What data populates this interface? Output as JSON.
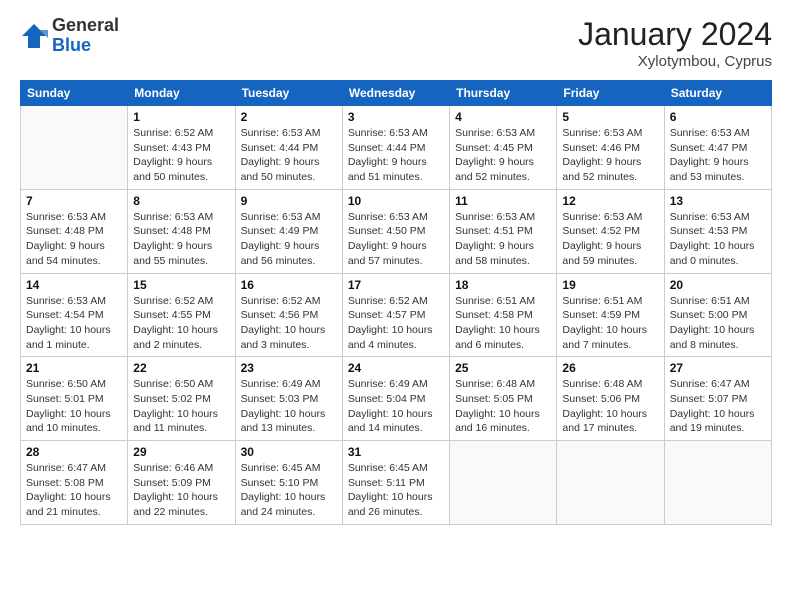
{
  "header": {
    "logo_general": "General",
    "logo_blue": "Blue",
    "month_title": "January 2024",
    "subtitle": "Xylotymbou, Cyprus"
  },
  "weekdays": [
    "Sunday",
    "Monday",
    "Tuesday",
    "Wednesday",
    "Thursday",
    "Friday",
    "Saturday"
  ],
  "weeks": [
    [
      {
        "day": "",
        "info": ""
      },
      {
        "day": "1",
        "info": "Sunrise: 6:52 AM\nSunset: 4:43 PM\nDaylight: 9 hours\nand 50 minutes."
      },
      {
        "day": "2",
        "info": "Sunrise: 6:53 AM\nSunset: 4:44 PM\nDaylight: 9 hours\nand 50 minutes."
      },
      {
        "day": "3",
        "info": "Sunrise: 6:53 AM\nSunset: 4:44 PM\nDaylight: 9 hours\nand 51 minutes."
      },
      {
        "day": "4",
        "info": "Sunrise: 6:53 AM\nSunset: 4:45 PM\nDaylight: 9 hours\nand 52 minutes."
      },
      {
        "day": "5",
        "info": "Sunrise: 6:53 AM\nSunset: 4:46 PM\nDaylight: 9 hours\nand 52 minutes."
      },
      {
        "day": "6",
        "info": "Sunrise: 6:53 AM\nSunset: 4:47 PM\nDaylight: 9 hours\nand 53 minutes."
      }
    ],
    [
      {
        "day": "7",
        "info": "Sunrise: 6:53 AM\nSunset: 4:48 PM\nDaylight: 9 hours\nand 54 minutes."
      },
      {
        "day": "8",
        "info": "Sunrise: 6:53 AM\nSunset: 4:48 PM\nDaylight: 9 hours\nand 55 minutes."
      },
      {
        "day": "9",
        "info": "Sunrise: 6:53 AM\nSunset: 4:49 PM\nDaylight: 9 hours\nand 56 minutes."
      },
      {
        "day": "10",
        "info": "Sunrise: 6:53 AM\nSunset: 4:50 PM\nDaylight: 9 hours\nand 57 minutes."
      },
      {
        "day": "11",
        "info": "Sunrise: 6:53 AM\nSunset: 4:51 PM\nDaylight: 9 hours\nand 58 minutes."
      },
      {
        "day": "12",
        "info": "Sunrise: 6:53 AM\nSunset: 4:52 PM\nDaylight: 9 hours\nand 59 minutes."
      },
      {
        "day": "13",
        "info": "Sunrise: 6:53 AM\nSunset: 4:53 PM\nDaylight: 10 hours\nand 0 minutes."
      }
    ],
    [
      {
        "day": "14",
        "info": "Sunrise: 6:53 AM\nSunset: 4:54 PM\nDaylight: 10 hours\nand 1 minute."
      },
      {
        "day": "15",
        "info": "Sunrise: 6:52 AM\nSunset: 4:55 PM\nDaylight: 10 hours\nand 2 minutes."
      },
      {
        "day": "16",
        "info": "Sunrise: 6:52 AM\nSunset: 4:56 PM\nDaylight: 10 hours\nand 3 minutes."
      },
      {
        "day": "17",
        "info": "Sunrise: 6:52 AM\nSunset: 4:57 PM\nDaylight: 10 hours\nand 4 minutes."
      },
      {
        "day": "18",
        "info": "Sunrise: 6:51 AM\nSunset: 4:58 PM\nDaylight: 10 hours\nand 6 minutes."
      },
      {
        "day": "19",
        "info": "Sunrise: 6:51 AM\nSunset: 4:59 PM\nDaylight: 10 hours\nand 7 minutes."
      },
      {
        "day": "20",
        "info": "Sunrise: 6:51 AM\nSunset: 5:00 PM\nDaylight: 10 hours\nand 8 minutes."
      }
    ],
    [
      {
        "day": "21",
        "info": "Sunrise: 6:50 AM\nSunset: 5:01 PM\nDaylight: 10 hours\nand 10 minutes."
      },
      {
        "day": "22",
        "info": "Sunrise: 6:50 AM\nSunset: 5:02 PM\nDaylight: 10 hours\nand 11 minutes."
      },
      {
        "day": "23",
        "info": "Sunrise: 6:49 AM\nSunset: 5:03 PM\nDaylight: 10 hours\nand 13 minutes."
      },
      {
        "day": "24",
        "info": "Sunrise: 6:49 AM\nSunset: 5:04 PM\nDaylight: 10 hours\nand 14 minutes."
      },
      {
        "day": "25",
        "info": "Sunrise: 6:48 AM\nSunset: 5:05 PM\nDaylight: 10 hours\nand 16 minutes."
      },
      {
        "day": "26",
        "info": "Sunrise: 6:48 AM\nSunset: 5:06 PM\nDaylight: 10 hours\nand 17 minutes."
      },
      {
        "day": "27",
        "info": "Sunrise: 6:47 AM\nSunset: 5:07 PM\nDaylight: 10 hours\nand 19 minutes."
      }
    ],
    [
      {
        "day": "28",
        "info": "Sunrise: 6:47 AM\nSunset: 5:08 PM\nDaylight: 10 hours\nand 21 minutes."
      },
      {
        "day": "29",
        "info": "Sunrise: 6:46 AM\nSunset: 5:09 PM\nDaylight: 10 hours\nand 22 minutes."
      },
      {
        "day": "30",
        "info": "Sunrise: 6:45 AM\nSunset: 5:10 PM\nDaylight: 10 hours\nand 24 minutes."
      },
      {
        "day": "31",
        "info": "Sunrise: 6:45 AM\nSunset: 5:11 PM\nDaylight: 10 hours\nand 26 minutes."
      },
      {
        "day": "",
        "info": ""
      },
      {
        "day": "",
        "info": ""
      },
      {
        "day": "",
        "info": ""
      }
    ]
  ]
}
